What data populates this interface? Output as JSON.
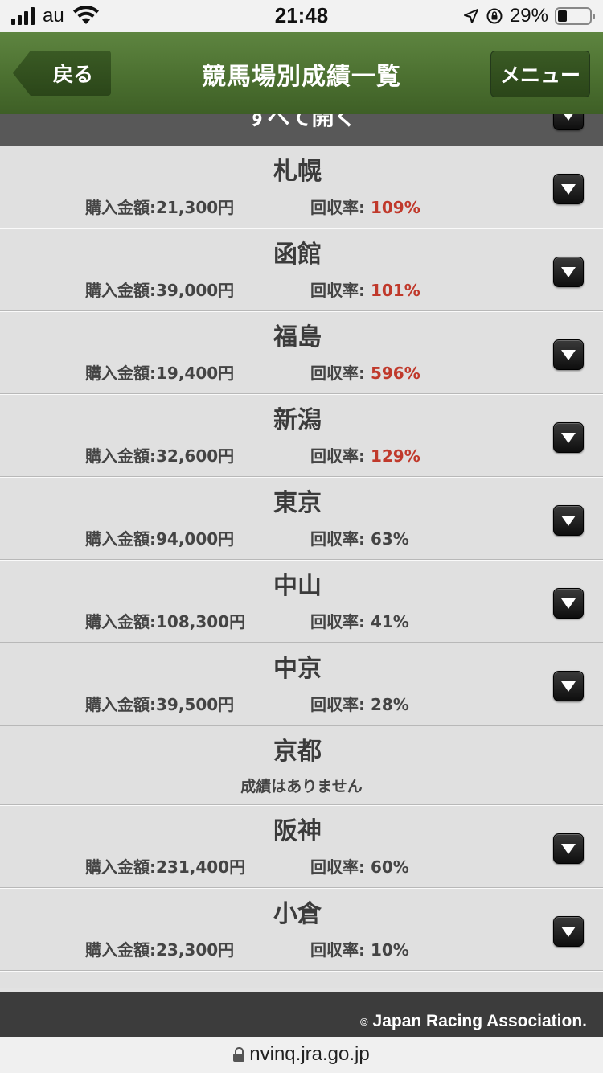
{
  "status_bar": {
    "carrier": "au",
    "time": "21:48",
    "battery_percent": "29%"
  },
  "nav": {
    "back_label": "戻る",
    "title": "競馬場別成績一覧",
    "menu_label": "メニュー"
  },
  "expand_all_label": "すべて開く",
  "amount_prefix": "購入金額:",
  "rate_prefix": "回収率: ",
  "colors": {
    "profit": "#c0392b",
    "loss": "#444444",
    "nav_green": "#4a6e2f"
  },
  "tracks": [
    {
      "name": "札幌",
      "amount": "21,300円",
      "rate": "109%",
      "profit": true
    },
    {
      "name": "函館",
      "amount": "39,000円",
      "rate": "101%",
      "profit": true
    },
    {
      "name": "福島",
      "amount": "19,400円",
      "rate": "596%",
      "profit": true
    },
    {
      "name": "新潟",
      "amount": "32,600円",
      "rate": "129%",
      "profit": true
    },
    {
      "name": "東京",
      "amount": "94,000円",
      "rate": "63%",
      "profit": false
    },
    {
      "name": "中山",
      "amount": "108,300円",
      "rate": "41%",
      "profit": false
    },
    {
      "name": "中京",
      "amount": "39,500円",
      "rate": "28%",
      "profit": false
    },
    {
      "name": "京都",
      "no_record": "成績はありません"
    },
    {
      "name": "阪神",
      "amount": "231,400円",
      "rate": "60%",
      "profit": false
    },
    {
      "name": "小倉",
      "amount": "23,300円",
      "rate": "10%",
      "profit": false
    }
  ],
  "footer": {
    "copyright": "Japan Racing Association."
  },
  "url": "nvinq.jra.go.jp"
}
